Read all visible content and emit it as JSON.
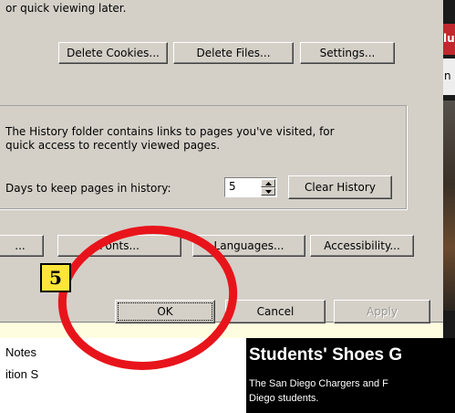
{
  "dialog": {
    "top_text": "or quick viewing later.",
    "temp_files_buttons": [
      "Delete Cookies...",
      "Delete Files...",
      "Settings..."
    ],
    "history_desc_line1": "The History folder contains links to pages you've visited, for",
    "history_desc_line2": "quick access to recently viewed pages.",
    "days_label": "Days to keep pages in history:",
    "days_value": "5",
    "clear_history_label": "Clear History",
    "bottom_buttons": [
      "...",
      "Fonts...",
      "Languages...",
      "Accessibility..."
    ],
    "ok_label": "OK",
    "cancel_label": "Cancel",
    "apply_label": "Apply"
  },
  "background_left": {
    "items": [
      "Notes",
      "ition S"
    ]
  },
  "webpage": {
    "red_tab_letter": "lu",
    "white_letter": "n",
    "headline": "Students' Shoes G",
    "sub_line1": "The San Diego Chargers and F",
    "sub_line2": "Diego students."
  },
  "annotation": {
    "step_number": "5",
    "highlight_color": "#E8141B",
    "badge_color": "#FFE53A",
    "frame_color": "#FFFDE0"
  }
}
